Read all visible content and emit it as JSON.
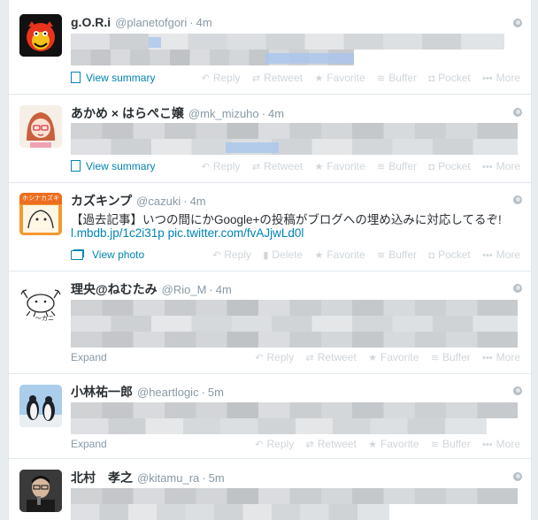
{
  "tweets": [
    {
      "name": "g.O.R.i",
      "handle": "@planetofgori",
      "time": "4m",
      "footer": "View summary"
    },
    {
      "name": "あかめ × はらぺこ嬢",
      "handle": "@mk_mizuho",
      "time": "4m",
      "footer": "View summary"
    },
    {
      "name": "カズキンプ",
      "handle": "@cazuki",
      "time": "4m",
      "text": "【過去記事】いつの間にかGoogle+の投稿がブログへの埋め込みに対応してるぞ!",
      "link": "l.mbdb.jp/1c2i31p pic.twitter.com/fvAJjwLd0l",
      "footer": "View photo"
    },
    {
      "name": "理央@ねむたみ",
      "handle": "@Rio_M",
      "time": "4m",
      "footer": "Expand"
    },
    {
      "name": "小林祐一郎",
      "handle": "@heartlogic",
      "time": "5m",
      "footer": "Expand"
    },
    {
      "name": "北村　孝之",
      "handle": "@kitamu_ra",
      "time": "5m"
    }
  ],
  "actions": {
    "reply": "Reply",
    "retweet": "Retweet",
    "delete": "Delete",
    "favorite": "Favorite",
    "buffer": "Buffer",
    "pocket": "Pocket",
    "more": "More"
  },
  "avatar3_text": "ホシナカズキ",
  "avatar4_text": "〜カニ"
}
